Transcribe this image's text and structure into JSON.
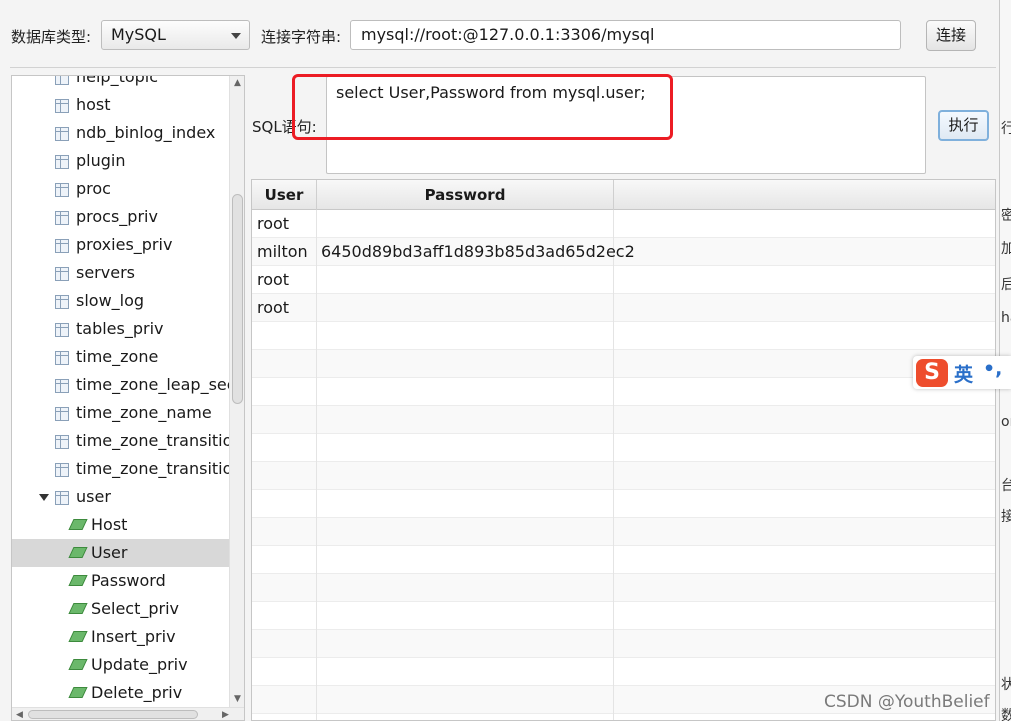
{
  "toolbar": {
    "db_type_label": "数据库类型:",
    "db_type_value": "MySQL",
    "conn_label": "连接字符串:",
    "conn_value": "mysql://root:@127.0.0.1:3306/mysql",
    "connect_button": "连接"
  },
  "sql": {
    "label": "SQL语句:",
    "query": "select User,Password from mysql.user;",
    "execute_button": "执行"
  },
  "tree": {
    "tables": [
      "help_topic",
      "host",
      "ndb_binlog_index",
      "plugin",
      "proc",
      "procs_priv",
      "proxies_priv",
      "servers",
      "slow_log",
      "tables_priv",
      "time_zone",
      "time_zone_leap_second",
      "time_zone_name",
      "time_zone_transition",
      "time_zone_transition_type"
    ],
    "expanded_table": "user",
    "columns": [
      "Host",
      "User",
      "Password",
      "Select_priv",
      "Insert_priv",
      "Update_priv",
      "Delete_priv"
    ],
    "selected_column": "User"
  },
  "result": {
    "headers": [
      "User",
      "Password"
    ],
    "rows": [
      [
        "root",
        ""
      ],
      [
        "milton",
        "6450d89bd3aff1d893b85d3ad65d2ec2"
      ],
      [
        "root",
        ""
      ],
      [
        "root",
        ""
      ]
    ]
  },
  "ime": {
    "mode": "英",
    "punct": "•,",
    "logo": "S"
  },
  "background_window_fragments": [
    "行",
    "密码",
    "加",
    "后利",
    "ha",
    "or",
    "台",
    "接",
    "状",
    "数"
  ],
  "watermark": "CSDN @YouthBelief"
}
